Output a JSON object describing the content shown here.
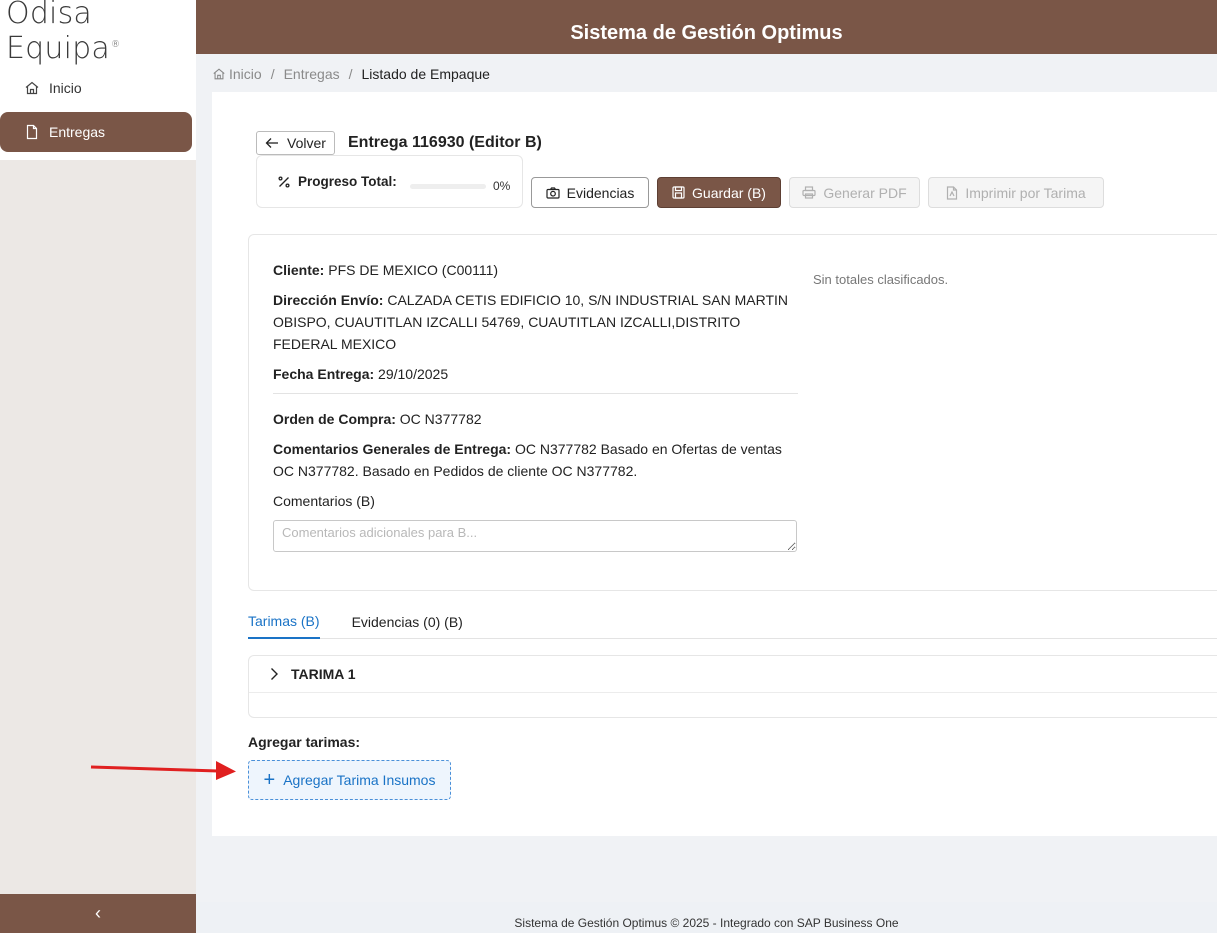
{
  "logo": {
    "text": "Odisa Equipa",
    "mark": "®"
  },
  "sidebar": {
    "items": [
      {
        "label": "Inicio",
        "icon": "home-icon"
      },
      {
        "label": "Entregas",
        "icon": "document-icon",
        "active": true
      }
    ],
    "collapse_icon": "‹"
  },
  "header": {
    "title": "Sistema de Gestión Optimus"
  },
  "breadcrumb": {
    "home": "Inicio",
    "section": "Entregas",
    "current": "Listado de Empaque",
    "separator": "/"
  },
  "page": {
    "back_label": "Volver",
    "title": "Entrega 116930 (Editor B)",
    "progress": {
      "label": "Progreso Total:",
      "value_text": "0%",
      "value": 0
    },
    "buttons": {
      "evidencias": "Evidencias",
      "guardar": "Guardar (B)",
      "generar_pdf": "Generar PDF",
      "imprimir": "Imprimir por Tarima"
    }
  },
  "info": {
    "cliente_label": "Cliente:",
    "cliente_value": "PFS DE MEXICO (C00111)",
    "direccion_label": "Dirección Envío:",
    "direccion_value": "CALZADA CETIS EDIFICIO 10, S/N INDUSTRIAL SAN MARTIN OBISPO, CUAUTITLAN IZCALLI 54769, CUAUTITLAN IZCALLI,DISTRITO FEDERAL MEXICO",
    "fecha_label": "Fecha Entrega:",
    "fecha_value": "29/10/2025",
    "orden_label": "Orden de Compra:",
    "orden_value": "OC N377782",
    "comentarios_generales_label": "Comentarios Generales de Entrega:",
    "comentarios_generales_value": "OC N377782 Basado en Ofertas de ventas OC N377782. Basado en Pedidos de cliente OC N377782.",
    "comentarios_label": "Comentarios (B)",
    "comentarios_placeholder": "Comentarios adicionales para B...",
    "totales_text": "Sin totales clasificados."
  },
  "tabs": [
    {
      "label": "Tarimas (B)",
      "active": true
    },
    {
      "label": "Evidencias (0) (B)",
      "active": false
    }
  ],
  "tarimas": [
    {
      "title": "TARIMA 1"
    }
  ],
  "add": {
    "label": "Agregar tarimas:",
    "button": "Agregar Tarima Insumos"
  },
  "footer": {
    "text": "Sistema de Gestión Optimus © 2025 - Integrado con SAP Business One"
  },
  "colors": {
    "brand": "#7a5647",
    "accent": "#1a73c6",
    "annotation_arrow": "#e02020"
  }
}
